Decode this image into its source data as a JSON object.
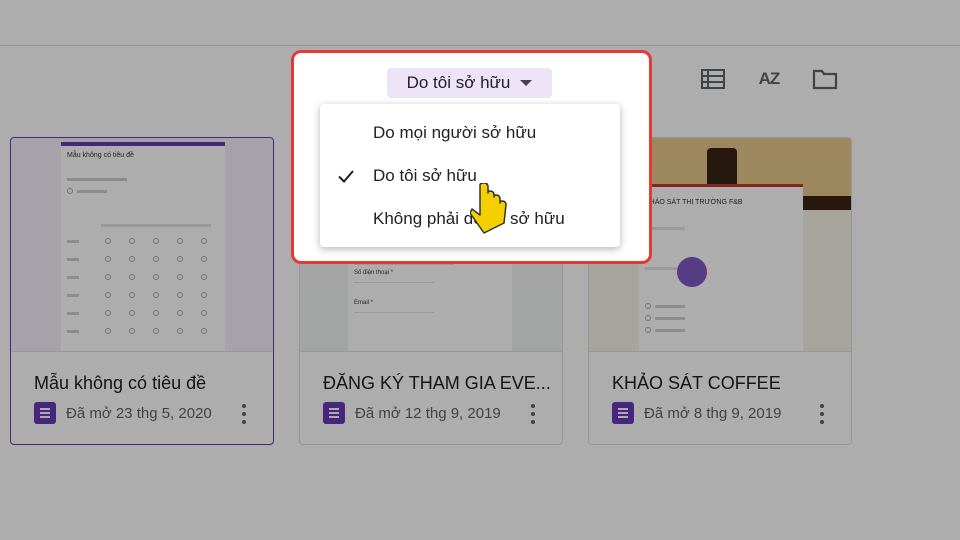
{
  "filter": {
    "label": "Do tôi sở hữu",
    "menu": [
      {
        "label": "Do mọi người sở hữu",
        "checked": false
      },
      {
        "label": "Do tôi sở hữu",
        "checked": true
      },
      {
        "label": "Không phải do tôi sở hữu",
        "checked": false
      }
    ]
  },
  "toolbar": {
    "icons": [
      "list-view-icon",
      "sort-az-icon",
      "folder-icon"
    ],
    "sort_label": "AZ"
  },
  "cards": [
    {
      "title": "Mẫu không có tiêu đề",
      "date": "Đã mở 23 thg 5, 2020",
      "thumb_title": "Mẫu không có tiêu đề",
      "selected": true
    },
    {
      "title": "ĐĂNG KÝ THAM GIA EVE...",
      "date": "Đã mở 12 thg 9, 2019",
      "thumb_field1": "Số điện thoại *",
      "thumb_field2": "Email *"
    },
    {
      "title": "KHẢO SÁT COFFEE",
      "date": "Đã mở 8 thg 9, 2019",
      "thumb_title": "KHẢO SÁT THỊ TRƯỜNG F&B"
    }
  ],
  "colors": {
    "accent": "#673ab7",
    "highlight_border": "#e53935",
    "filter_bg": "#ede4f7",
    "cursor": "#f5d000"
  }
}
